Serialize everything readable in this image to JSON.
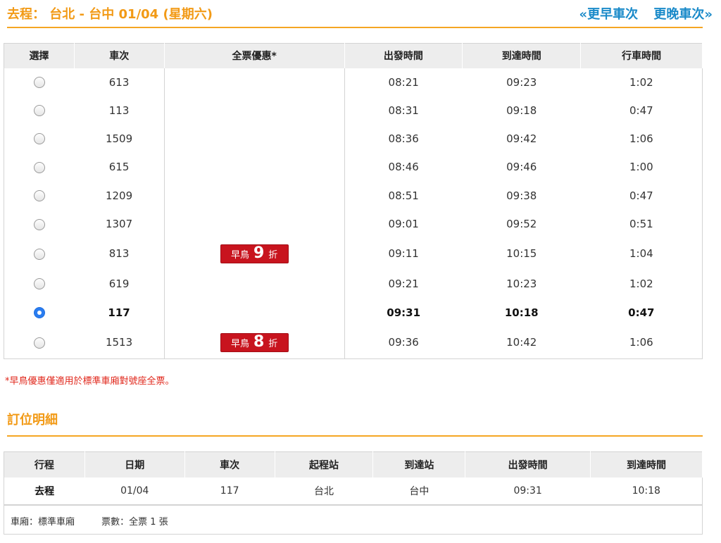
{
  "header": {
    "trip_title": "去程： 台北 - 台中 01/04 (星期六)",
    "earlier_link": "«更早車次",
    "later_link": "更晚車次»",
    "accent_color": "#f29a16",
    "link_color": "#1a8ac9"
  },
  "train_table": {
    "columns": [
      "選擇",
      "車次",
      "全票優惠*",
      "出發時間",
      "到達時間",
      "行車時間"
    ],
    "rows": [
      {
        "train": "613",
        "discount": "",
        "depart": "08:21",
        "arrive": "09:23",
        "duration": "1:02",
        "selected": false
      },
      {
        "train": "113",
        "discount": "",
        "depart": "08:31",
        "arrive": "09:18",
        "duration": "0:47",
        "selected": false
      },
      {
        "train": "1509",
        "discount": "",
        "depart": "08:36",
        "arrive": "09:42",
        "duration": "1:06",
        "selected": false
      },
      {
        "train": "615",
        "discount": "",
        "depart": "08:46",
        "arrive": "09:46",
        "duration": "1:00",
        "selected": false
      },
      {
        "train": "1209",
        "discount": "",
        "depart": "08:51",
        "arrive": "09:38",
        "duration": "0:47",
        "selected": false
      },
      {
        "train": "1307",
        "discount": "",
        "depart": "09:01",
        "arrive": "09:52",
        "duration": "0:51",
        "selected": false
      },
      {
        "train": "813",
        "discount": {
          "prefix": "早鳥",
          "num": "9",
          "suffix": "折"
        },
        "depart": "09:11",
        "arrive": "10:15",
        "duration": "1:04",
        "selected": false
      },
      {
        "train": "619",
        "discount": "",
        "depart": "09:21",
        "arrive": "10:23",
        "duration": "1:02",
        "selected": false
      },
      {
        "train": "117",
        "discount": "",
        "depart": "09:31",
        "arrive": "10:18",
        "duration": "0:47",
        "selected": true
      },
      {
        "train": "1513",
        "discount": {
          "prefix": "早鳥",
          "num": "8",
          "suffix": "折"
        },
        "depart": "09:36",
        "arrive": "10:42",
        "duration": "1:06",
        "selected": false
      }
    ],
    "row_heights": [
      40,
      40,
      40,
      41,
      40,
      41,
      43,
      42,
      40,
      46
    ]
  },
  "footnote": "*早鳥優惠僅適用於標準車廂對號座全票。",
  "detail": {
    "title": "訂位明細",
    "columns": [
      "行程",
      "日期",
      "車次",
      "起程站",
      "到達站",
      "出發時間",
      "到達時間"
    ],
    "row": {
      "trip": "去程",
      "date": "01/04",
      "train": "117",
      "from": "台北",
      "to": "台中",
      "depart": "09:31",
      "arrive": "10:18"
    },
    "car_type": "車廂：標準車廂",
    "tickets": "票數：全票 1 張"
  }
}
